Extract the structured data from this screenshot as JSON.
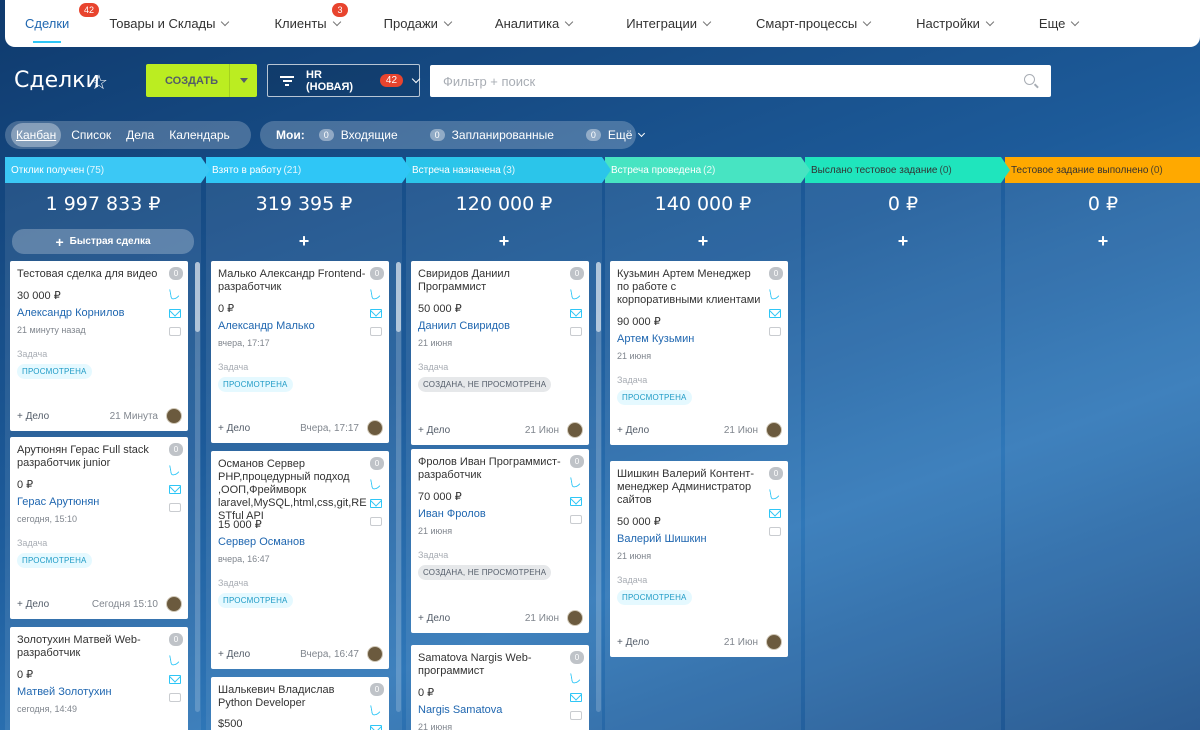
{
  "nav": {
    "items": [
      {
        "label": "Сделки",
        "badge": "42"
      },
      {
        "label": "Товары и Склады"
      },
      {
        "label": "Клиенты",
        "badge": "3"
      },
      {
        "label": "Продажи"
      },
      {
        "label": "Аналитика"
      },
      {
        "label": "Интеграции"
      },
      {
        "label": "Смарт-процессы"
      },
      {
        "label": "Настройки"
      },
      {
        "label": "Еще"
      }
    ]
  },
  "header": {
    "title": "Сделки",
    "create_label": "СОЗДАТЬ",
    "filter_label": "HR (НОВАЯ)",
    "filter_badge": "42",
    "search_placeholder": "Фильтр + поиск"
  },
  "views": {
    "items": [
      "Канбан",
      "Список",
      "Дела",
      "Календарь"
    ]
  },
  "counters": {
    "mine_label": "Мои:",
    "items": [
      {
        "num": "0",
        "label": "Входящие"
      },
      {
        "num": "0",
        "label": "Запланированные"
      },
      {
        "num": "0",
        "label": "Ещё"
      }
    ]
  },
  "common": {
    "quick_deal": "Быстрая сделка",
    "task_label": "Задача",
    "add_label": "+ Дело",
    "zero": "0"
  },
  "colors": {
    "stage1": "#3bc8f5",
    "stage2": "#2fc6f6",
    "stage3": "#2bc5ea",
    "stage4": "#47e4c2",
    "stage5": "#1fe5bd",
    "stage6": "#ffa900"
  },
  "columns": [
    {
      "stage": "Отклик получен",
      "count": "(75)",
      "sum": "1 997 833 ₽",
      "cards": [
        {
          "title": "Тестовая сделка для видео",
          "amount": "30 000 ₽",
          "contact": "Александр Корнилов",
          "date": "21 минуту назад",
          "status": "ПРОСМОТРЕНА",
          "when": "21 Минута"
        },
        {
          "title": "Арутюнян Герас Full stack разработчик junior",
          "amount": "0 ₽",
          "contact": "Герас Арутюнян",
          "date": "сегодня, 15:10",
          "status": "ПРОСМОТРЕНА",
          "when": "Сегодня 15:10"
        },
        {
          "title": "Золотухин Матвей Web-разработчик",
          "amount": "0 ₽",
          "contact": "Матвей Золотухин",
          "date": "сегодня, 14:49"
        }
      ]
    },
    {
      "stage": "Взято в работу",
      "count": "(21)",
      "sum": "319 395 ₽",
      "cards": [
        {
          "title": "Малько Александр Frontend-разработчик",
          "amount": "0 ₽",
          "contact": "Александр Малько",
          "date": "вчера, 17:17",
          "status": "ПРОСМОТРЕНА",
          "when": "Вчера, 17:17"
        },
        {
          "title": "Османов Сервер PHP,процедурный подход ,ООП,Фреймворк laravel,MySQL,html,css,git,RE STful API",
          "amount": "15 000 ₽",
          "contact": "Сервер Османов",
          "date": "вчера, 16:47",
          "status": "ПРОСМОТРЕНА",
          "when": "Вчера, 16:47"
        },
        {
          "title": "Шалькевич Владислав Python Developer",
          "amount": "$500"
        }
      ]
    },
    {
      "stage": "Встреча назначена",
      "count": "(3)",
      "sum": "120 000 ₽",
      "cards": [
        {
          "title": "Свиридов Даниил Программист",
          "amount": "50 000 ₽",
          "contact": "Даниил Свиридов",
          "date": "21 июня",
          "status": "СОЗДАНА, НЕ ПРОСМОТРЕНА",
          "when": "21 Июн"
        },
        {
          "title": "Фролов Иван Программист-разработчик",
          "amount": "70 000 ₽",
          "contact": "Иван Фролов",
          "date": "21 июня",
          "status": "СОЗДАНА, НЕ ПРОСМОТРЕНА",
          "when": "21 Июн"
        },
        {
          "title": "Samatova Nargis Web-программист",
          "amount": "0 ₽",
          "contact": "Nargis Samatova",
          "date": "21 июня"
        }
      ]
    },
    {
      "stage": "Встреча проведена",
      "count": "(2)",
      "sum": "140 000 ₽",
      "cards": [
        {
          "title": "Кузьмин Артем Менеджер по работе с корпоративными клиентами",
          "amount": "90 000 ₽",
          "contact": "Артем Кузьмин",
          "date": "21 июня",
          "status": "ПРОСМОТРЕНА",
          "when": "21 Июн"
        },
        {
          "title": "Шишкин Валерий Контент-менеджер Администратор сайтов",
          "amount": "50 000 ₽",
          "contact": "Валерий Шишкин",
          "date": "21 июня",
          "status": "ПРОСМОТРЕНА",
          "when": "21 Июн"
        }
      ]
    },
    {
      "stage": "Выслано тестовое задание",
      "count": "(0)",
      "sum": "0 ₽",
      "cards": []
    },
    {
      "stage": "Тестовое задание выполнено",
      "count": "(0)",
      "sum": "0 ₽",
      "cards": []
    }
  ]
}
